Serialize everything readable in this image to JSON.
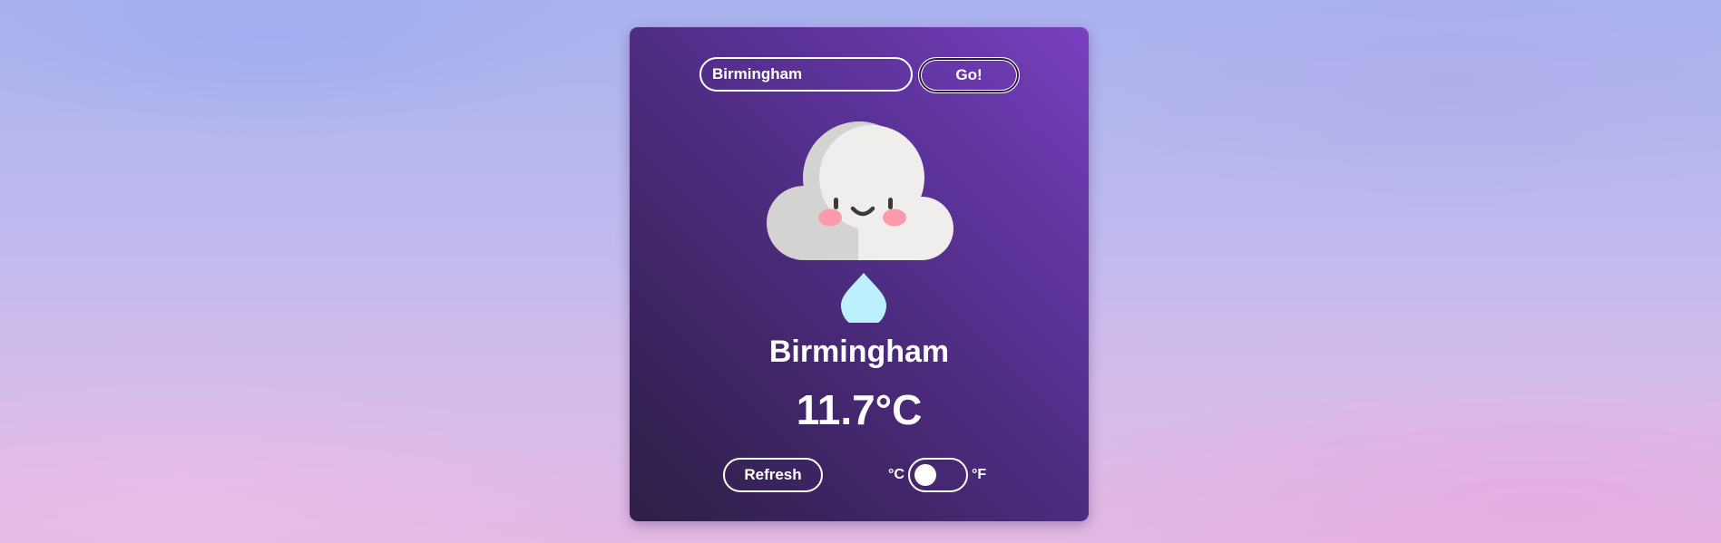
{
  "search": {
    "value": "Birmingham",
    "button_label": "Go!"
  },
  "weather": {
    "icon": "rain-cloud-icon",
    "city": "Birmingham",
    "temperature": "11.7°C"
  },
  "controls": {
    "refresh_label": "Refresh",
    "unit_celsius": "°C",
    "unit_fahrenheit": "°F",
    "selected_unit": "°C"
  },
  "colors": {
    "card_gradient_start": "#2d1f45",
    "card_gradient_end": "#7840be",
    "raindrop": "#bdf0ff",
    "cloud": "#efeeec",
    "blush": "#fb9aa8"
  }
}
